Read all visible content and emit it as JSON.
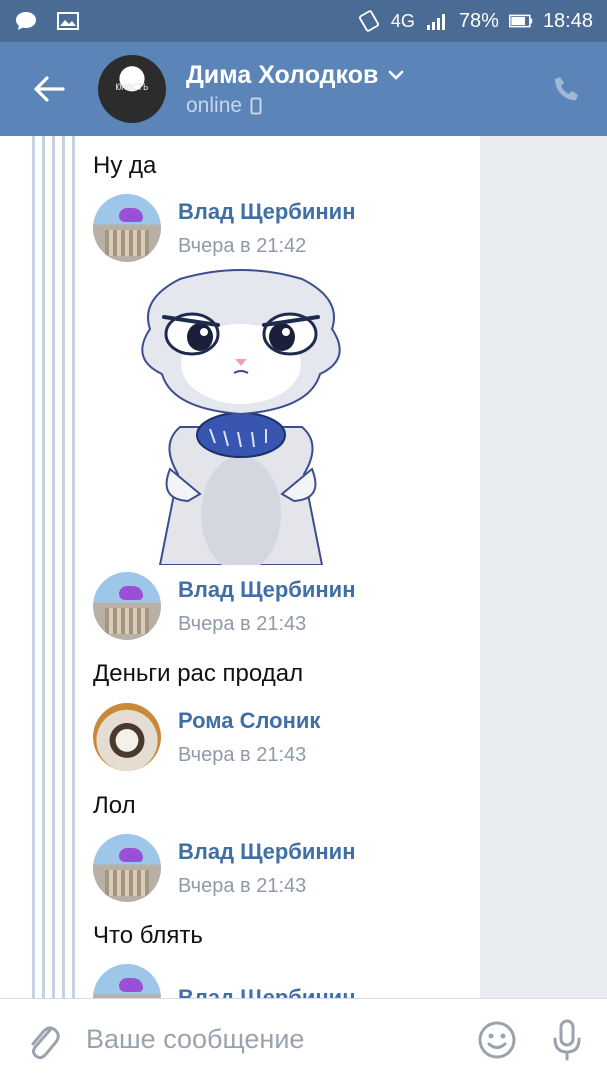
{
  "status_bar": {
    "network": "4G",
    "battery": "78%",
    "time": "18:48"
  },
  "header": {
    "name": "Дима Холодков",
    "status": "online",
    "avatar_text": "ЮНВСТЬ"
  },
  "messages": [
    {
      "text": "Ну да"
    },
    {
      "author": "Влад Щербинин",
      "time": "Вчера в 21:42"
    },
    {
      "author": "Влад Щербинин",
      "time": "Вчера в 21:43"
    },
    {
      "text": "Деньги рас продал"
    },
    {
      "author": "Рома Слоник",
      "time": "Вчера в 21:43"
    },
    {
      "text": "Лол"
    },
    {
      "author": "Влад Щербинин",
      "time": "Вчера в 21:43"
    },
    {
      "text": "Что блять"
    },
    {
      "author": "Влад Щербинин"
    }
  ],
  "composer": {
    "placeholder": "Ваше сообщение"
  },
  "colors": {
    "header": "#5b84b8",
    "statusbar": "#4a6b94",
    "author_link": "#3f6fa4"
  }
}
